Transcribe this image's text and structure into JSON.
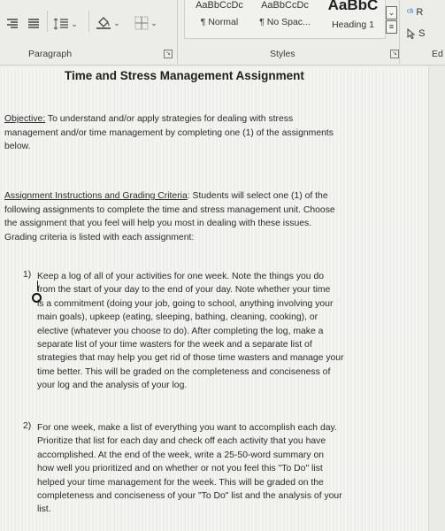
{
  "ribbon": {
    "paragraph_group": {
      "label": "Paragraph",
      "buttons": [
        {
          "name": "align-right",
          "icon": "align-right-icon"
        },
        {
          "name": "justify",
          "icon": "justify-icon"
        },
        {
          "name": "line-spacing",
          "icon": "line-spacing-icon"
        },
        {
          "name": "shading",
          "icon": "paint-bucket-icon"
        },
        {
          "name": "borders",
          "icon": "borders-icon"
        }
      ]
    },
    "styles_group": {
      "label": "Styles",
      "items": [
        {
          "preview": "AaBbCcDc",
          "name": "¶ Normal"
        },
        {
          "preview": "AaBbCcDc",
          "name": "¶ No Spac..."
        },
        {
          "preview": "AaBbC",
          "name": "Heading 1"
        }
      ]
    },
    "editing_group": {
      "label": "Ed",
      "items": [
        {
          "icon": "replace-icon",
          "label": "R"
        },
        {
          "icon": "select-cursor-icon",
          "label": "S"
        }
      ]
    }
  },
  "document": {
    "title": "Time and Stress Management Assignment",
    "objective": {
      "label": "Objective:",
      "lines": [
        " To understand and/or apply strategies for dealing with stress",
        "management and/or time management by completing one (1) of the assignments",
        "below."
      ]
    },
    "instructions": {
      "label": "Assignment Instructions and Grading Criteria",
      "lines": [
        ": Students will select one (1) of the",
        "following assignments to complete the time and stress management unit. Choose",
        "the assignment that you feel will help you most in dealing with these issues.",
        "Grading criteria is listed with each assignment:"
      ]
    },
    "assignments": [
      {
        "number": "1)",
        "lines": [
          "Keep a log of all of your activities for one week. Note the things you do",
          "from the start of your day to the end of your day. Note whether your time",
          "is a commitment (doing your job, going to school, anything involving your",
          "main goals), upkeep (eating, sleeping, bathing, cleaning, cooking), or",
          "elective (whatever you choose to do). After completing the log, make a",
          "separate list of your time wasters for the week and a separate list of",
          "strategies that may help you get rid of those time wasters and manage your",
          "time better. This will be graded on the completeness and conciseness of",
          "your log and the analysis of your log."
        ]
      },
      {
        "number": "2)",
        "lines": [
          "For one week, make a list of everything you want to accomplish each day.",
          "Prioritize that list for each day and check off each activity that you have",
          "accomplished. At the end of the week, write a 25-50-word summary on",
          "how well you prioritized and on whether or not you feel this \"To Do\" list",
          "helped your time management for the week. This will be graded on the",
          "completeness and conciseness of your \"To Do\" list and the analysis of your",
          "list."
        ]
      }
    ]
  }
}
